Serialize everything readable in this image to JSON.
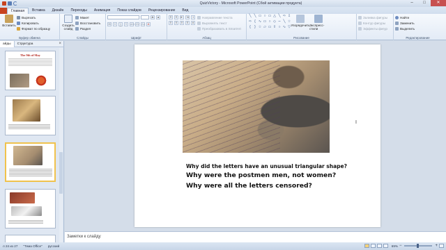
{
  "window": {
    "title": "QuizVictory - Microsoft PowerPoint (Сбой активации продукта)",
    "minimize": "–",
    "maximize": "□",
    "close": "✕"
  },
  "tabs": [
    "Главная",
    "Вставка",
    "Дизайн",
    "Переходы",
    "Анимация",
    "Показ слайдов",
    "Рецензирование",
    "Вид"
  ],
  "ribbon": {
    "clipboard": {
      "label": "Буфер обмена",
      "paste": "Вставить",
      "cut": "Вырезать",
      "copy": "Копировать",
      "format_painter": "Формат по образцу"
    },
    "slides": {
      "label": "Слайды",
      "new_slide": "Создать слайд",
      "layout": "Макет",
      "reset": "Восстановить",
      "section": "Раздел"
    },
    "font": {
      "label": "Шрифт"
    },
    "paragraph": {
      "label": "Абзац",
      "text_direction": "Направление текста",
      "align_text": "Выровнять текст",
      "smartart": "Преобразовать в SmartArt"
    },
    "drawing": {
      "label": "Рисование",
      "arrange": "Упорядочить",
      "quick_styles": "Экспресс-стили",
      "shape_fill": "Заливка фигуры",
      "shape_outline": "Контур фигуры",
      "shape_effects": "Эффекты фигур"
    },
    "editing": {
      "label": "Редактирование",
      "find": "Найти",
      "replace": "Заменить",
      "select": "Выделить"
    }
  },
  "left_panel": {
    "tab_slides": "айды",
    "tab_outline": "Структура",
    "slide1_title": "The 9th of May"
  },
  "slide": {
    "q1": "Why did the letters have an unusual  triangular shape?",
    "q2": "Why were the postmen men, not women?",
    "q3": "Why were all the letters censored?"
  },
  "notes": {
    "placeholder": "Заметки к слайду"
  },
  "status": {
    "slide_pos": "л 24 из 27",
    "theme": "\"Тема Office\"",
    "language": "русский",
    "zoom": "69%"
  },
  "colors": {
    "accent": "#c8431f",
    "selected_thumb": "#f0c24c"
  }
}
